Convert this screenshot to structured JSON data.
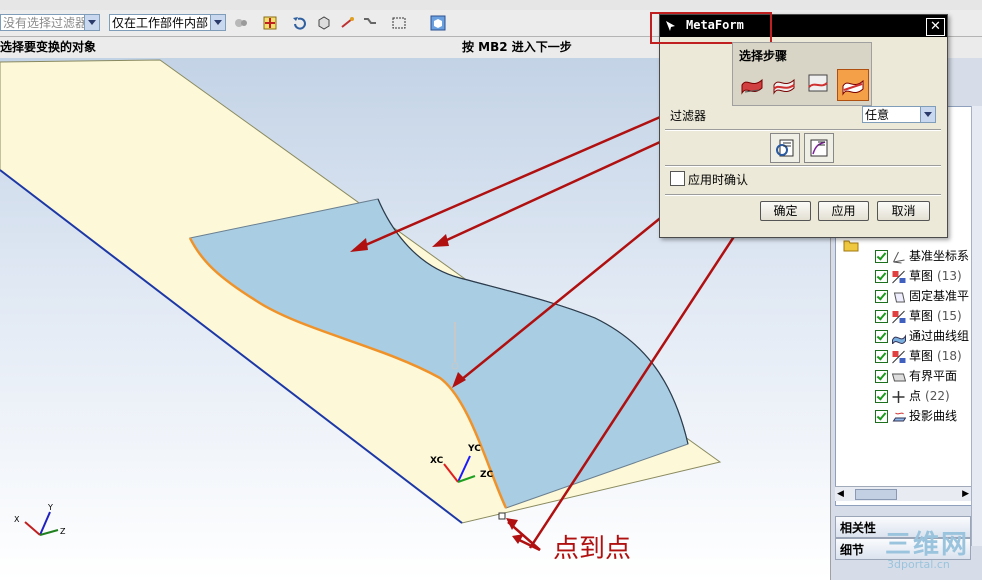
{
  "toolbar": {
    "filter_combo": "没有选择过滤器",
    "scope_combo": "仅在工作部件内部"
  },
  "status": {
    "prompt": "选择要变换的对象",
    "hint": "按 MB2 进入下一步"
  },
  "dialog": {
    "title": "MetaForm",
    "section_title": "选择步骤",
    "filter_label": "过滤器",
    "filter_value": "任意",
    "confirm_checkbox_label": "应用时确认",
    "ok_label": "确定",
    "apply_label": "应用",
    "cancel_label": "取消"
  },
  "part_navigator": {
    "items": [
      {
        "label": "基准坐标系",
        "icon": "datum-csys-icon",
        "checked": true
      },
      {
        "label": "草图",
        "count": "(13)",
        "icon": "sketch-icon",
        "checked": true
      },
      {
        "label": "固定基准平",
        "icon": "datum-plane-icon",
        "checked": true
      },
      {
        "label": "草图",
        "count": "(15)",
        "icon": "sketch-icon",
        "checked": true
      },
      {
        "label": "通过曲线组",
        "icon": "through-curves-icon",
        "checked": true
      },
      {
        "label": "草图",
        "count": "(18)",
        "icon": "sketch-icon",
        "checked": true
      },
      {
        "label": "有界平面",
        "icon": "bounded-plane-icon",
        "checked": true
      },
      {
        "label": "点",
        "count": "(22)",
        "icon": "point-icon",
        "checked": true
      },
      {
        "label": "投影曲线",
        "icon": "projected-curve-icon",
        "checked": true
      }
    ],
    "dependencies_label": "相关性",
    "details_label": "细节"
  },
  "viewport": {
    "wcs_labels": {
      "xc": "XC",
      "yc": "YC",
      "zc": "ZC"
    },
    "abs_axes": {
      "x": "X",
      "y": "Y",
      "z": "Z"
    },
    "annotation": "点到点"
  },
  "watermark": {
    "main": "三维网",
    "url": "3dportal.cn"
  },
  "colors": {
    "annotation_red": "#b01010",
    "title_bar": "#000000",
    "surface": "#a9cde3",
    "sheet": "#fdf9d8",
    "edge_highlight": "#f0922a"
  }
}
